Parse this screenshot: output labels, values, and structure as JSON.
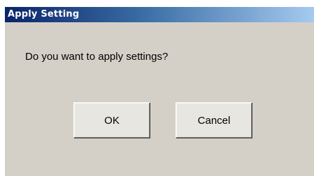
{
  "dialog": {
    "title": "Apply Setting",
    "message": "Do you want to apply settings?",
    "buttons": {
      "ok_label": "OK",
      "cancel_label": "Cancel"
    }
  },
  "colors": {
    "title_bar_start": "#0a246a",
    "title_bar_end": "#a6caf0",
    "dialog_background": "#d4d0c8",
    "title_text": "#ffffff"
  }
}
